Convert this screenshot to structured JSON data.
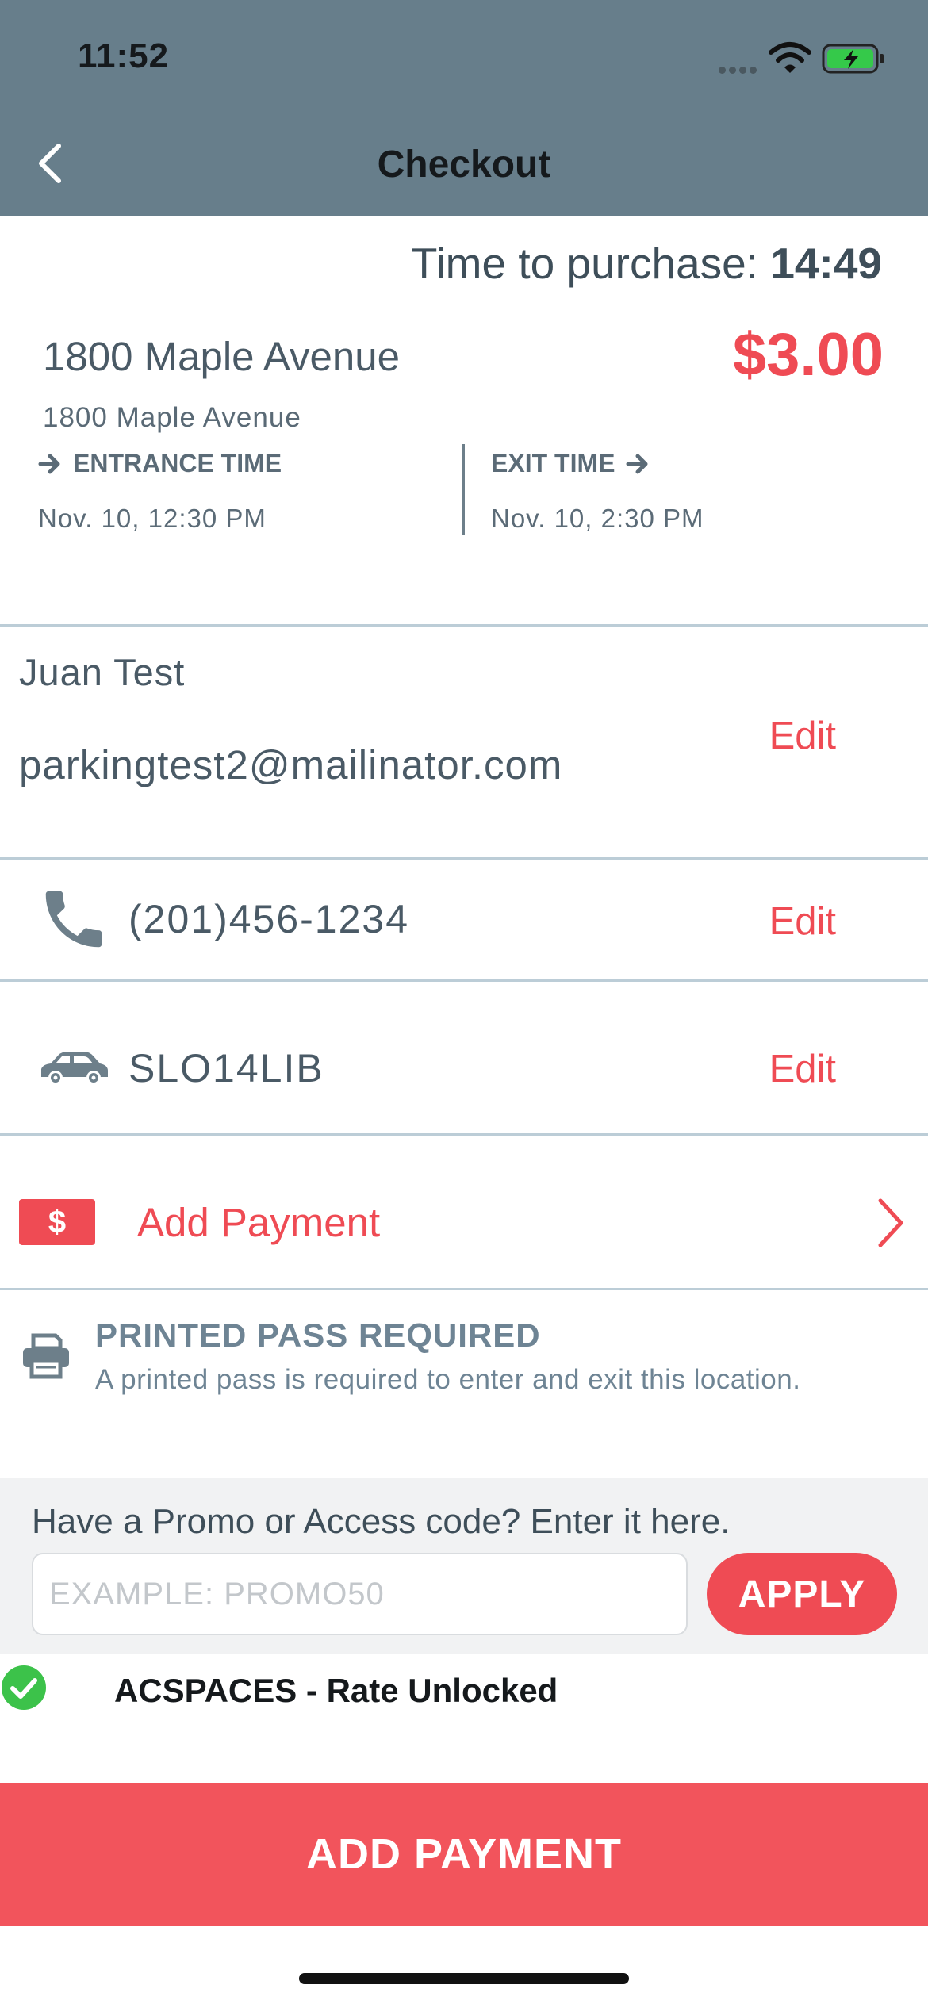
{
  "status_bar": {
    "time": "11:52"
  },
  "header": {
    "title": "Checkout",
    "back_icon": "chevron-left-icon"
  },
  "purchase_timer": {
    "label": "Time to purchase:",
    "value": "14:49"
  },
  "location": {
    "name": "1800 Maple Avenue",
    "address": "1800 Maple Avenue",
    "price": "$3.00"
  },
  "entrance": {
    "label": "ENTRANCE TIME",
    "value": "Nov. 10, 12:30 PM"
  },
  "exit": {
    "label": "EXIT TIME",
    "value": "Nov. 10, 2:30 PM"
  },
  "contact": {
    "name": "Juan Test",
    "email": "parkingtest2@mailinator.com",
    "edit_label": "Edit"
  },
  "phone": {
    "number": "(201)456-1234",
    "edit_label": "Edit",
    "icon": "phone-icon"
  },
  "vehicle": {
    "plate": "SLO14LIB",
    "edit_label": "Edit",
    "icon": "car-icon"
  },
  "payment": {
    "badge": "$",
    "label": "Add Payment",
    "icon": "chevron-right-icon"
  },
  "printed_pass": {
    "title": "PRINTED PASS REQUIRED",
    "description": "A printed pass is required to enter and exit this location.",
    "icon": "printer-icon"
  },
  "promo": {
    "label": "Have a Promo or Access code? Enter it here.",
    "placeholder": "EXAMPLE: PROMO50",
    "value": "",
    "apply_label": "APPLY",
    "status": "ACSPACES - Rate Unlocked"
  },
  "cta": {
    "label": "ADD PAYMENT"
  },
  "colors": {
    "header_bg": "#677e8b",
    "accent": "#ef4b54",
    "success": "#3cc24a",
    "divider": "#bccdd7"
  }
}
